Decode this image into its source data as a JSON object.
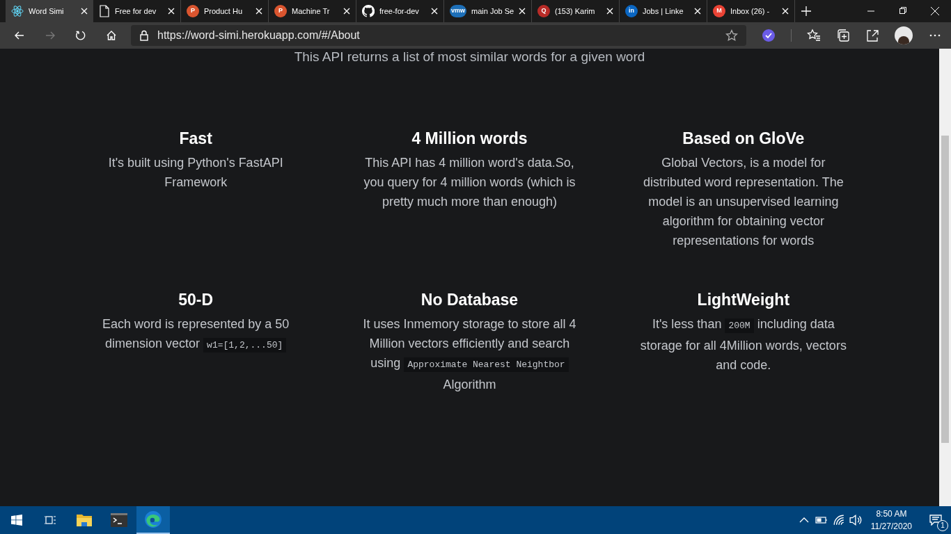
{
  "browser": {
    "tabs": [
      {
        "title": "Word Simi",
        "kind": "atom",
        "selected": true
      },
      {
        "title": "Free for dev",
        "kind": "page",
        "selected": false
      },
      {
        "title": "Product Hu",
        "kind": "letter",
        "icon_text": "P",
        "color": "#da552f",
        "selected": false
      },
      {
        "title": "Machine Tr",
        "kind": "letter",
        "icon_text": "P",
        "color": "#da552f",
        "selected": false
      },
      {
        "title": "free-for-dev",
        "kind": "github",
        "selected": false
      },
      {
        "title": "main Job Se",
        "kind": "letter",
        "icon_text": "vmw",
        "color": "#1d6fb8",
        "selected": false
      },
      {
        "title": "(153) Karim",
        "kind": "letter",
        "icon_text": "Q",
        "color": "#b92b27",
        "selected": false
      },
      {
        "title": "Jobs | Linke",
        "kind": "letter",
        "icon_text": "in",
        "color": "#0a66c2",
        "selected": false
      },
      {
        "title": "Inbox (26) -",
        "kind": "letter",
        "icon_text": "M",
        "color": "#ea4335",
        "selected": false
      }
    ],
    "url": "https://word-simi.herokuapp.com/#/About"
  },
  "page": {
    "subtitle": "This API returns a list of most similar words for a given word",
    "features": [
      {
        "title": "Fast",
        "description": [
          {
            "kind": "text",
            "text": "It's built using Python's FastAPI Framework"
          }
        ]
      },
      {
        "title": "4 Million words",
        "description": [
          {
            "kind": "text",
            "text": "This API has 4 million word's data.So, you query for 4 million words (which is pretty much more than enough)"
          }
        ]
      },
      {
        "title": "Based on GloVe",
        "description": [
          {
            "kind": "text",
            "text": "Global Vectors, is a model for distributed word representation. The model is an unsupervised learning algorithm for obtaining vector representations for words"
          }
        ]
      },
      {
        "title": "50-D",
        "description": [
          {
            "kind": "text",
            "text": "Each word is represented by a 50 dimension vector "
          },
          {
            "kind": "code",
            "text": "w1=[1,2,...50]"
          }
        ]
      },
      {
        "title": "No Database",
        "description": [
          {
            "kind": "text",
            "text": "It uses Inmemory storage to store all 4 Million vectors efficiently and search using "
          },
          {
            "kind": "code",
            "text": "Approximate Nearest Neightbor"
          },
          {
            "kind": "text",
            "text": " Algorithm"
          }
        ]
      },
      {
        "title": "LightWeight",
        "description": [
          {
            "kind": "text",
            "text": "It's less than "
          },
          {
            "kind": "code",
            "text": "200M"
          },
          {
            "kind": "text",
            "text": " including data storage for all 4Million words, vectors and code."
          }
        ]
      }
    ]
  },
  "taskbar": {
    "time": "8:50 AM",
    "date": "11/27/2020",
    "notifications": "1"
  }
}
